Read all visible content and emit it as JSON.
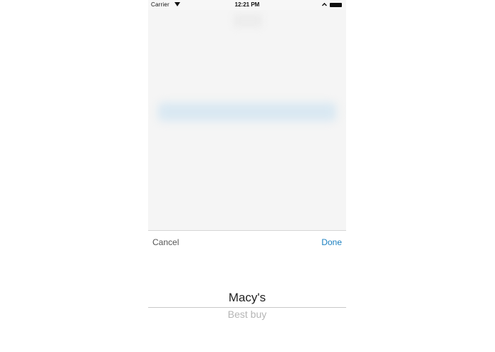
{
  "status_bar": {
    "carrier": "Carrier",
    "time": "12:21 PM"
  },
  "toolbar": {
    "cancel_label": "Cancel",
    "done_label": "Done"
  },
  "picker": {
    "selected": "Macy's",
    "next": "Best buy"
  },
  "colors": {
    "accent": "#1a7fc0"
  }
}
